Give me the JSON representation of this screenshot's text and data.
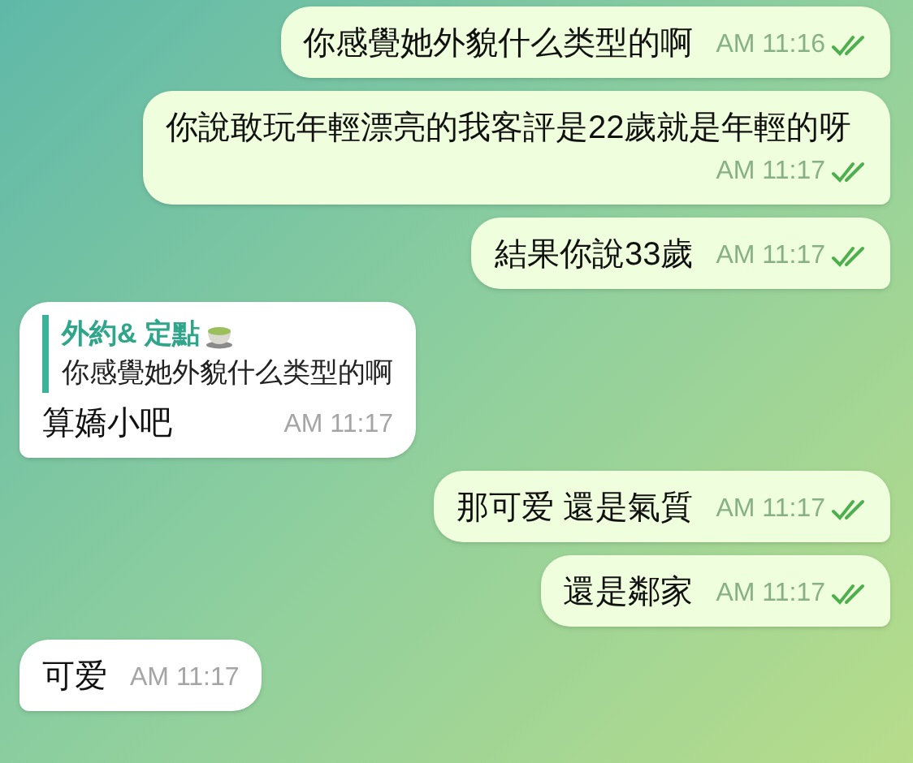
{
  "messages": [
    {
      "kind": "out",
      "text": "你感覺她外貌什么类型的啊",
      "time": "AM 11:16",
      "read": true
    },
    {
      "kind": "out",
      "text": "你說敢玩年輕漂亮的我客評是22歲就是年輕的呀",
      "time": "AM 11:17",
      "read": true
    },
    {
      "kind": "out",
      "text": "結果你說33歲",
      "time": "AM 11:17",
      "read": true
    },
    {
      "kind": "in",
      "reply": {
        "author": "外約& 定點",
        "text": "你感覺她外貌什么类型的啊"
      },
      "text": "算嬌小吧",
      "time": "AM 11:17"
    },
    {
      "kind": "out",
      "text": "那可爱 還是氣質",
      "time": "AM 11:17",
      "read": true
    },
    {
      "kind": "out",
      "text": "還是鄰家",
      "time": "AM 11:17",
      "read": true
    },
    {
      "kind": "in",
      "text": "可爱",
      "time": "AM 11:17"
    }
  ]
}
